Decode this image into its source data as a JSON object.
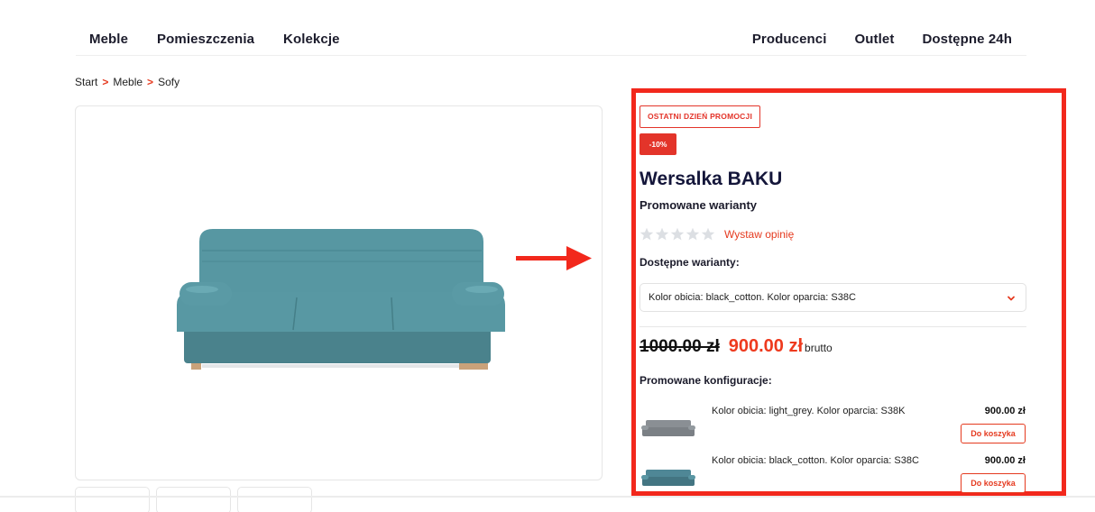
{
  "nav": {
    "left": [
      "Meble",
      "Pomieszczenia",
      "Kolekcje"
    ],
    "right": [
      "Producenci",
      "Outlet",
      "Dostępne 24h"
    ]
  },
  "breadcrumb": {
    "items": [
      "Start",
      "Meble",
      "Sofy"
    ],
    "separator": ">"
  },
  "product": {
    "badge_promo": "OSTATNI DZIEŃ PROMOCJI",
    "badge_discount": "-10%",
    "title": "Wersalka BAKU",
    "promoted_variants_label": "Promowane warianty",
    "rating_stars": 5,
    "rating_value": 0,
    "review_link": "Wystaw opinię",
    "available_variants_label": "Dostępne warianty:",
    "selected_variant": "Kolor obicia: black_cotton. Kolor oparcia: S38C",
    "old_price": "1000.00 zł",
    "new_price": "900.00 zł",
    "price_suffix": "brutto",
    "promoted_configs_label": "Promowane konfiguracje:",
    "configs": [
      {
        "label": "Kolor obicia: light_grey. Kolor oparcia: S38K",
        "price": "900.00 zł",
        "button": "Do koszyka",
        "color": "#8a8f94"
      },
      {
        "label": "Kolor obicia: black_cotton. Kolor oparcia: S38C",
        "price": "900.00 zł",
        "button": "Do koszyka",
        "color": "#4f8796"
      }
    ]
  },
  "colors": {
    "accent": "#e53a1f",
    "sale_price": "#ee3a1e",
    "highlight_frame": "#f2281c",
    "sofa_main": "#54919c",
    "title": "#14163a"
  },
  "icons": {
    "arrow": "arrow-right-icon",
    "chevron": "chevron-down-icon",
    "star": "star-icon"
  }
}
